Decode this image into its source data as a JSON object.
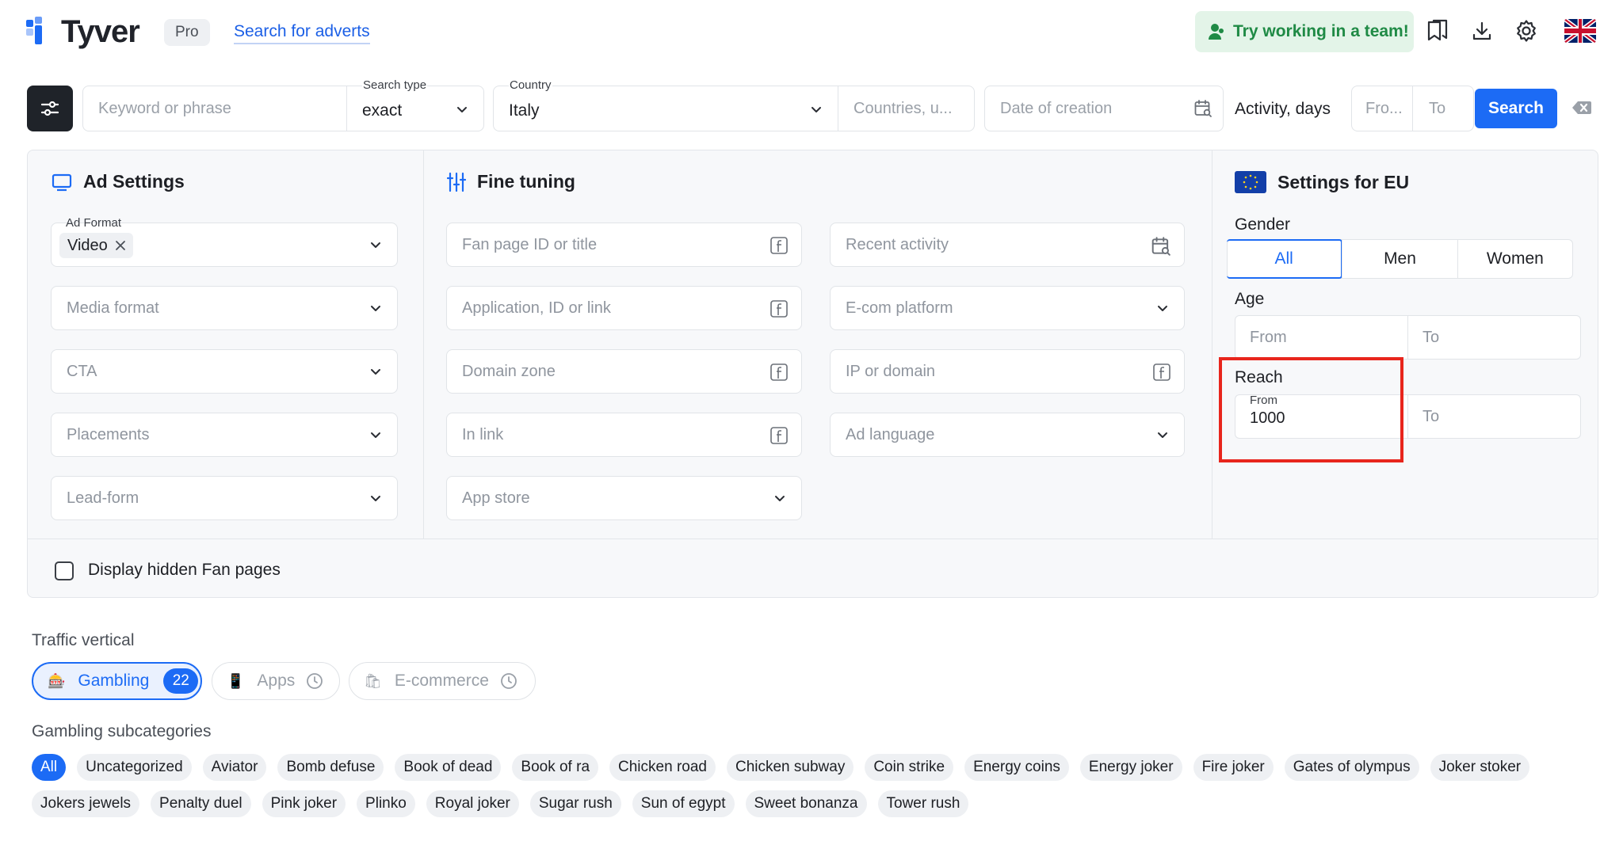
{
  "header": {
    "brand": "Tyver",
    "plan_badge": "Pro",
    "nav_link": "Search for adverts",
    "team_button": "Try working in a team!",
    "icons": [
      "bookmarks-icon",
      "download-icon",
      "gear-icon",
      "uk-flag-icon"
    ]
  },
  "searchbar": {
    "keyword_placeholder": "Keyword or phrase",
    "search_type_label": "Search type",
    "search_type_value": "exact",
    "country_label": "Country",
    "country_value": "Italy",
    "countries_placeholder": "Countries, u...",
    "date_placeholder": "Date of creation",
    "activity_label": "Activity, days",
    "activity_from": "Fro...",
    "activity_to": "To",
    "search_button": "Search"
  },
  "ad_settings": {
    "title": "Ad Settings",
    "ad_format_label": "Ad Format",
    "ad_format_chip": "Video",
    "media_format": "Media format",
    "cta": "CTA",
    "placements": "Placements",
    "lead_form": "Lead-form"
  },
  "fine_tuning": {
    "title": "Fine tuning",
    "fan_page": "Fan page ID or title",
    "application": "Application, ID or link",
    "domain_zone": "Domain zone",
    "in_link": "In link",
    "app_store": "App store",
    "recent_activity": "Recent activity",
    "ecom_platform": "E-com platform",
    "ip_domain": "IP or domain",
    "ad_language": "Ad language"
  },
  "eu_settings": {
    "title": "Settings for EU",
    "gender_label": "Gender",
    "gender_options": [
      "All",
      "Men",
      "Women"
    ],
    "gender_selected": "All",
    "age_label": "Age",
    "age_from": "From",
    "age_to": "To",
    "reach_label": "Reach",
    "reach_from_label": "From",
    "reach_from_value": "1000",
    "reach_to": "To",
    "highlight_color": "#e8251c"
  },
  "hidden_fan_pages": "Display hidden Fan pages",
  "traffic_vertical": {
    "label": "Traffic vertical",
    "items": [
      {
        "label": "Gambling",
        "count": "22",
        "active": true
      },
      {
        "label": "Apps",
        "active": false
      },
      {
        "label": "E-commerce",
        "active": false
      }
    ]
  },
  "gambling_subcategories": {
    "label": "Gambling subcategories",
    "tags": [
      "All",
      "Uncategorized",
      "Aviator",
      "Bomb defuse",
      "Book of dead",
      "Book of ra",
      "Chicken road",
      "Chicken subway",
      "Coin strike",
      "Energy coins",
      "Energy joker",
      "Fire joker",
      "Gates of olympus",
      "Joker stoker",
      "Jokers jewels",
      "Penalty duel",
      "Pink joker",
      "Plinko",
      "Royal joker",
      "Sugar rush",
      "Sun of egypt",
      "Sweet bonanza",
      "Tower rush"
    ],
    "selected": "All"
  },
  "colors": {
    "accent": "#1c6bf5",
    "team_green": "#1f8a45",
    "dark_button": "#1f2329"
  }
}
